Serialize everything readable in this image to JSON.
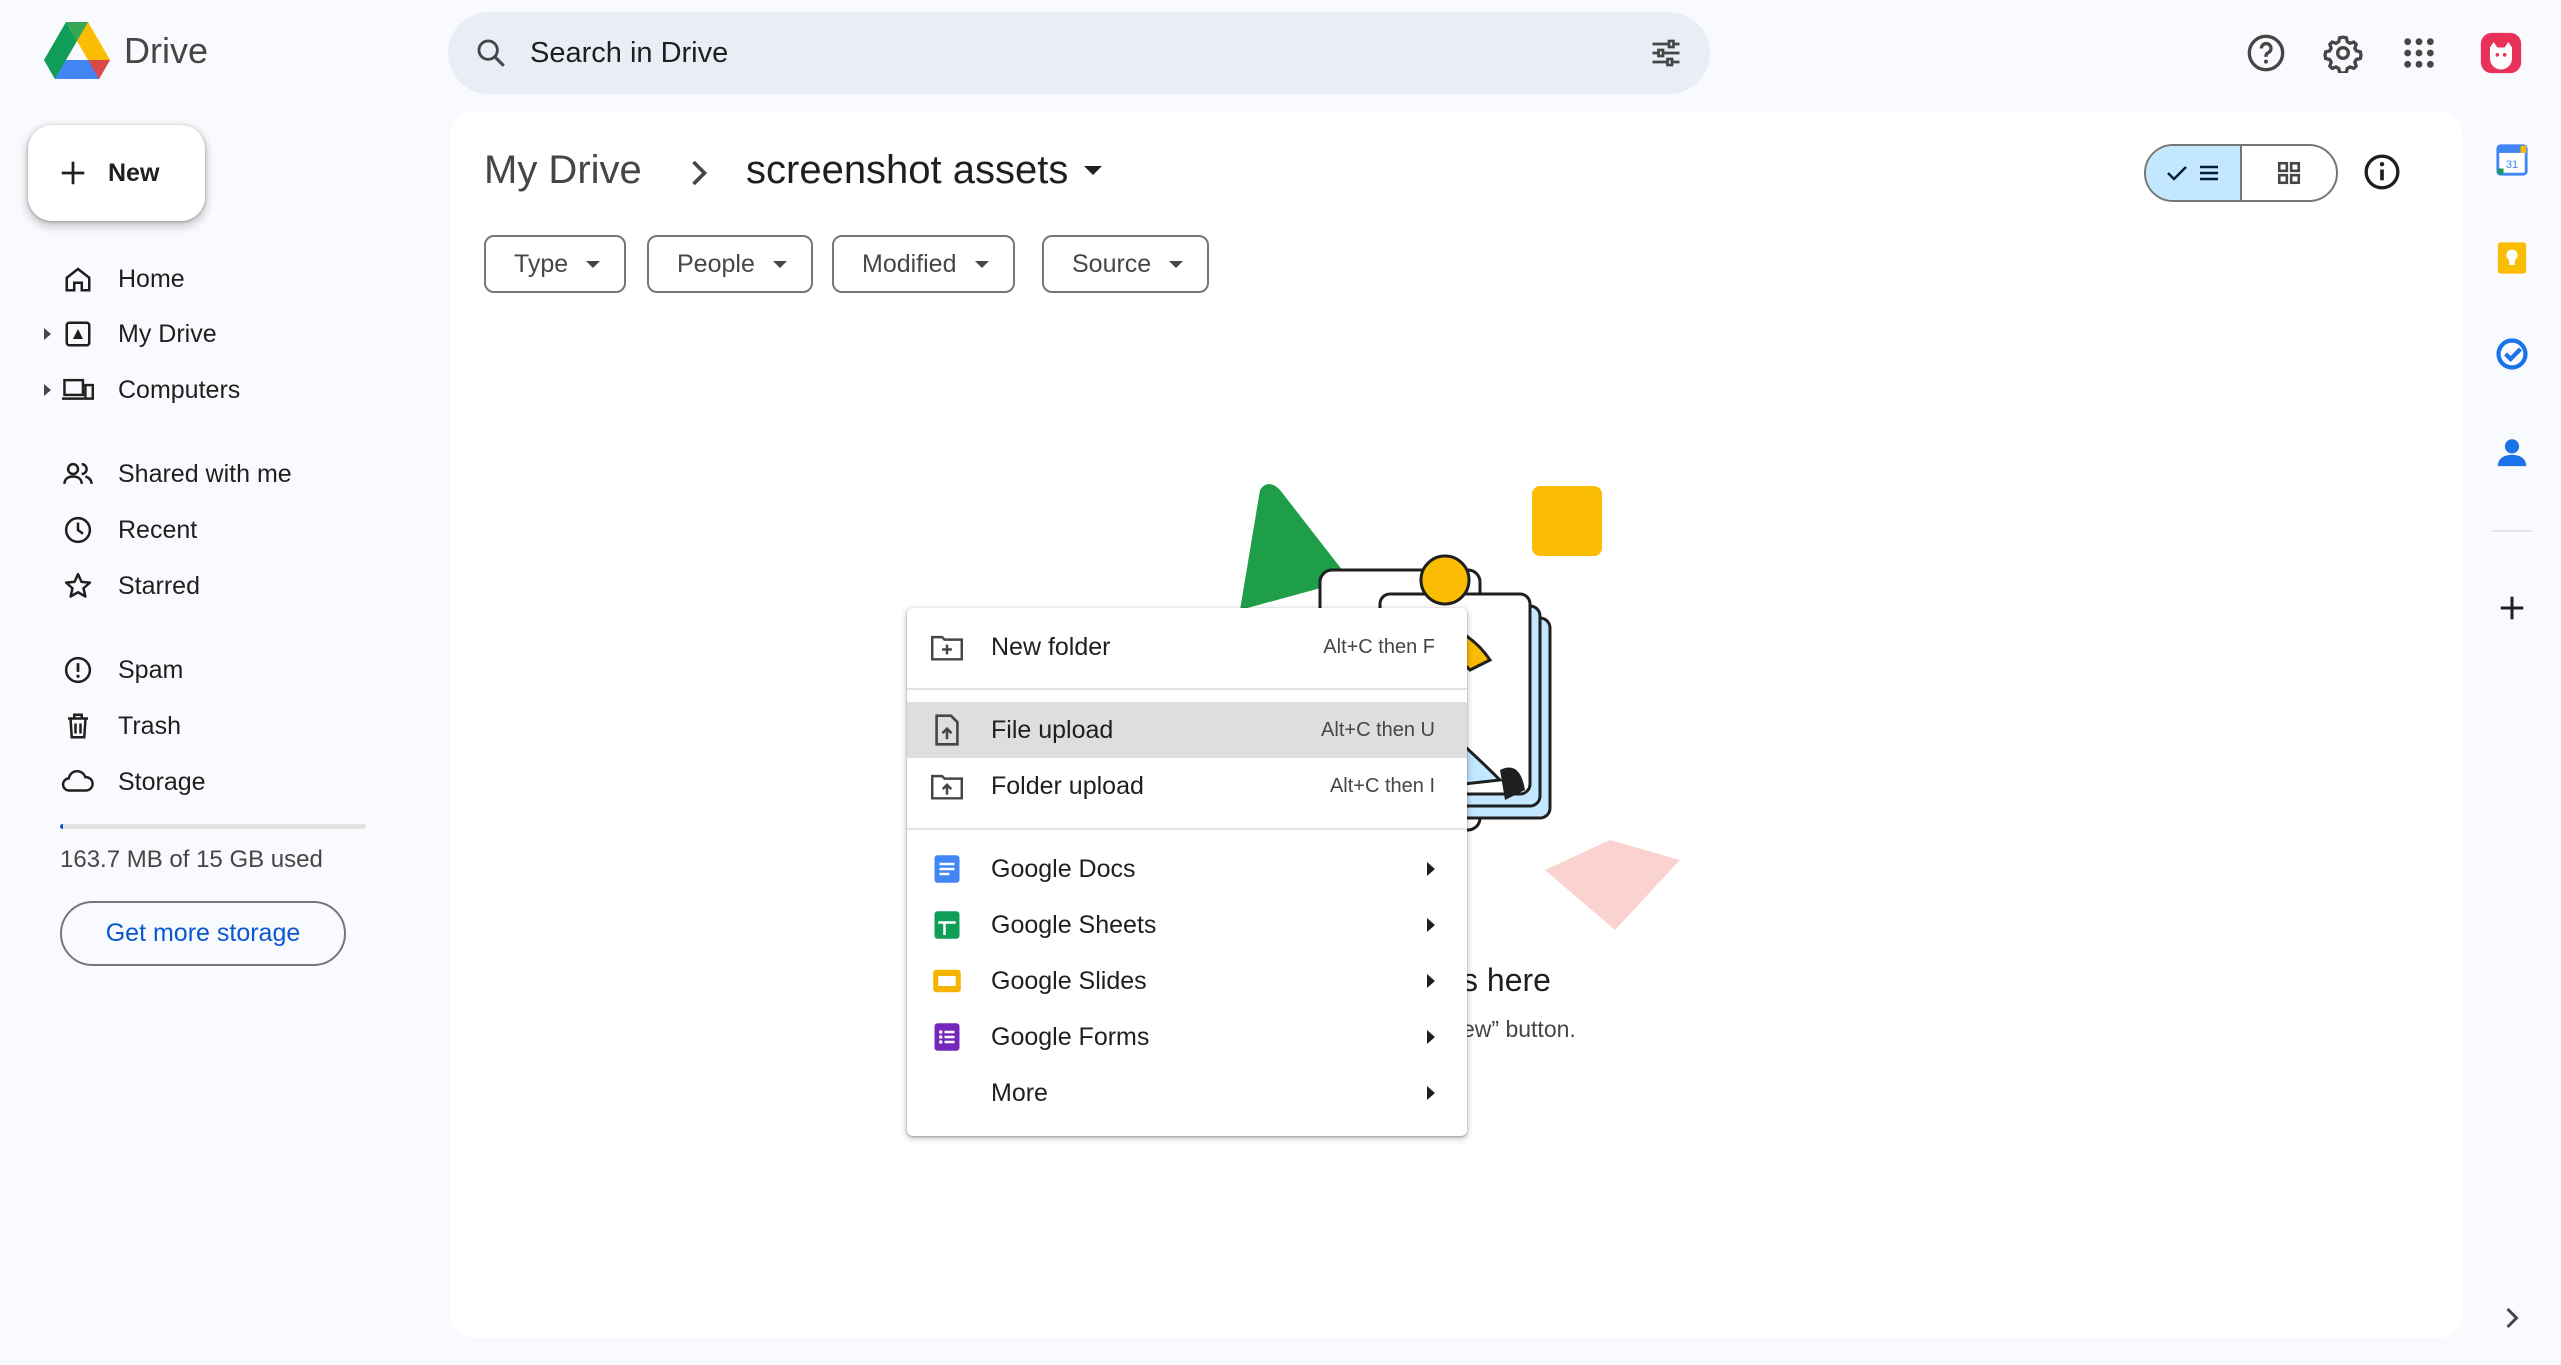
{
  "app": {
    "name": "Drive"
  },
  "search": {
    "placeholder": "Search in Drive"
  },
  "sidebar": {
    "new_label": "New",
    "items": [
      {
        "label": "Home",
        "icon": "home-icon"
      },
      {
        "label": "My Drive",
        "icon": "my-drive-icon"
      },
      {
        "label": "Computers",
        "icon": "computers-icon"
      },
      {
        "label": "Shared with me",
        "icon": "shared-icon"
      },
      {
        "label": "Recent",
        "icon": "clock-icon"
      },
      {
        "label": "Starred",
        "icon": "star-icon"
      },
      {
        "label": "Spam",
        "icon": "spam-icon"
      },
      {
        "label": "Trash",
        "icon": "trash-icon"
      },
      {
        "label": "Storage",
        "icon": "cloud-icon"
      }
    ],
    "storage_used_fraction": 0.011,
    "storage_text": "163.7 MB of 15 GB used",
    "get_storage_label": "Get more storage"
  },
  "breadcrumb": {
    "root": "My Drive",
    "current": "screenshot assets"
  },
  "filters": [
    "Type",
    "People",
    "Modified",
    "Source"
  ],
  "empty_state": {
    "title": "s here",
    "subtitle": "ew” button."
  },
  "menu": {
    "items": [
      {
        "label": "New folder",
        "shortcut": "Alt+C then F",
        "icon": "new-folder-icon"
      },
      {
        "label": "File upload",
        "shortcut": "Alt+C then U",
        "icon": "file-upload-icon",
        "highlighted": true
      },
      {
        "label": "Folder upload",
        "shortcut": "Alt+C then I",
        "icon": "folder-upload-icon"
      },
      {
        "label": "Google Docs",
        "icon": "google-docs-icon",
        "color": "#4285f4"
      },
      {
        "label": "Google Sheets",
        "icon": "google-sheets-icon",
        "color": "#0f9d58"
      },
      {
        "label": "Google Slides",
        "icon": "google-slides-icon",
        "color": "#f4b400"
      },
      {
        "label": "Google Forms",
        "icon": "google-forms-icon",
        "color": "#7627bb"
      },
      {
        "label": "More"
      }
    ]
  },
  "colors": {
    "accent": "#0b57d0",
    "selected": "#c2e7ff",
    "background": "#f8fafd"
  }
}
